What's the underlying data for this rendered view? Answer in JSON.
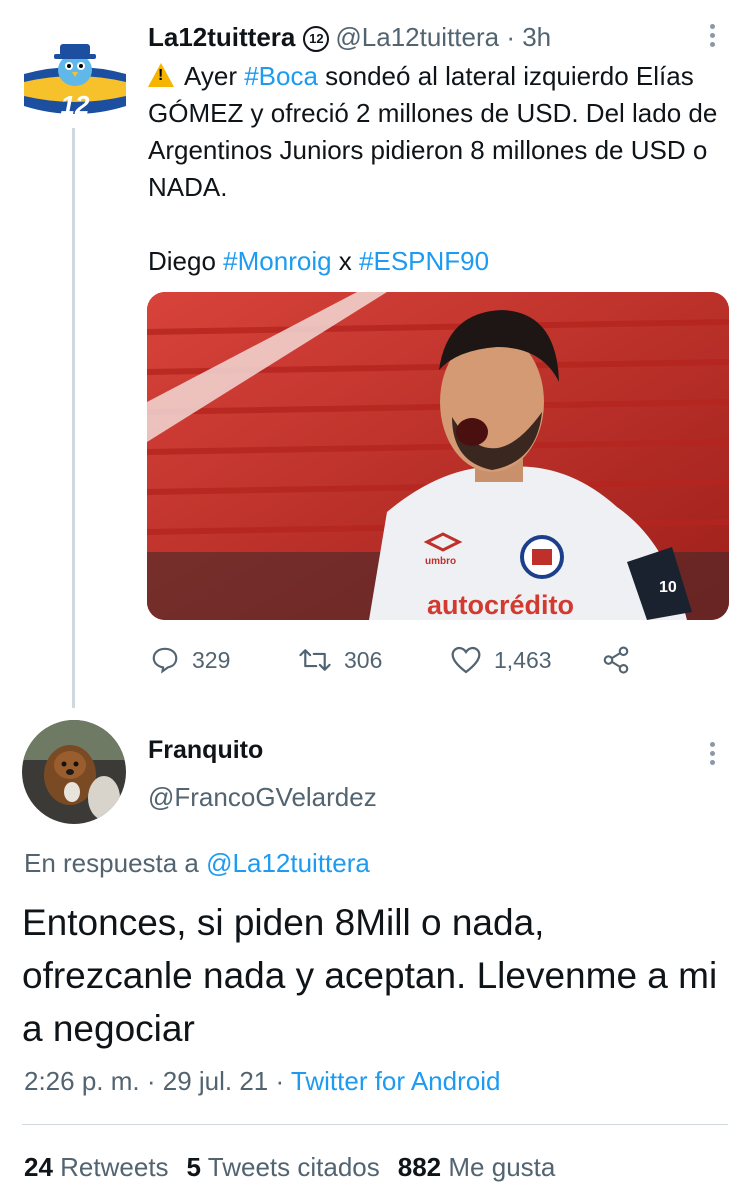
{
  "tweet": {
    "display_name": "La12tuittera",
    "badge": "12",
    "handle": "@La12tuittera",
    "time": "3h",
    "text_parts": {
      "line1_pre": "Ayer ",
      "hashtag_boca": "#Boca",
      "line1_post": " sondeó al lateral izquierdo Elías GÓMEZ y ofreció 2 millones de USD. Del lado de Argentinos Juniors pidieron 8 millones de USD o NADA.",
      "credit_pre": "Diego ",
      "hashtag_monroig": "#Monroig",
      "credit_mid": " x ",
      "hashtag_espn": "#ESPNF90"
    },
    "media": {
      "kit_brand": "umbro",
      "sponsor": "autocrédito",
      "captain_band": "10"
    },
    "actions": {
      "replies": "329",
      "retweets": "306",
      "likes": "1,463"
    }
  },
  "reply": {
    "display_name": "Franquito",
    "handle": "@FrancoGVelardez",
    "reply_to_label": "En respuesta a ",
    "reply_to_handle": "@La12tuittera",
    "text": "Entonces, si piden 8Mill o nada, ofrezcanle nada y aceptan. Llevenme a mi a negociar",
    "time": "2:26 p. m.",
    "date": "29 jul. 21",
    "source": "Twitter for Android",
    "stats": {
      "retweets_count": "24",
      "retweets_label": "Retweets",
      "quotes_count": "5",
      "quotes_label": "Tweets citados",
      "likes_count": "882",
      "likes_label": "Me gusta"
    }
  },
  "colors": {
    "link": "#1d9bf0",
    "muted": "#536471",
    "warning": "#f5b400",
    "boca_blue": "#1c4fa0",
    "boca_yellow": "#f6c12a"
  }
}
